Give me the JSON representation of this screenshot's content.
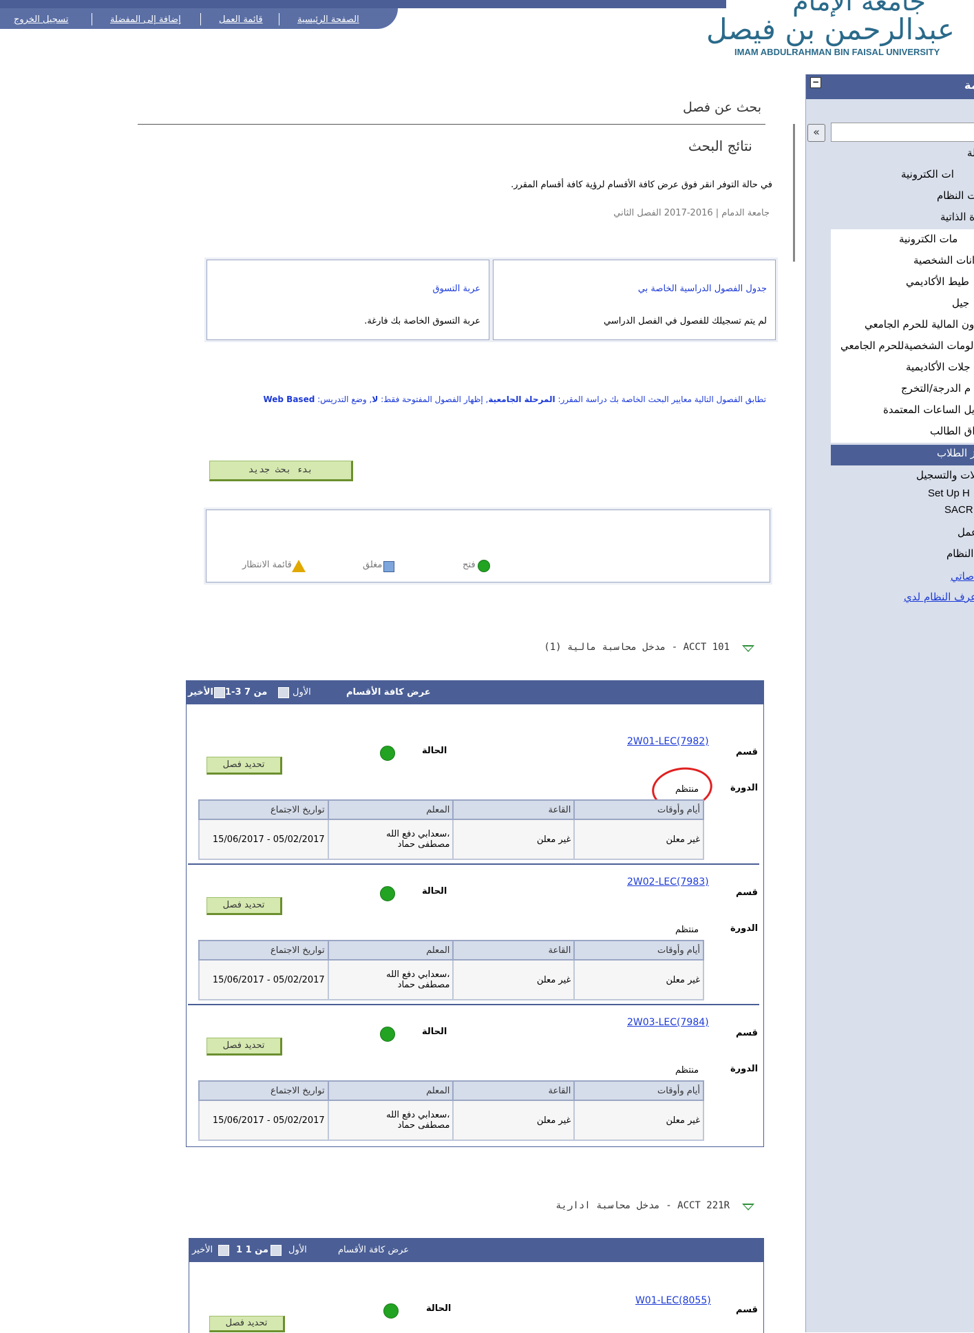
{
  "topnav": {
    "home": "الصفحة الرئيسية",
    "worklist": "قائمة العمل",
    "favorites": "إضافة إلى المفضلة",
    "logout": "تسجيل الخروج"
  },
  "logo": {
    "arabic_top": "جامعة الإمام",
    "arabic": "عبدالرحمن بن فيصل",
    "english": "IMAM ABDULRAHMAN BIN FAISAL UNIVERSITY"
  },
  "sidebar": {
    "title": "مة",
    "items": [
      "لة",
      "ات الكترونية",
      "ات النظام",
      "ة الذاتية",
      "مات الكترونية",
      "انات الشخصية",
      "طيط الأكاديمي",
      "جيل",
      "ون المالية للحرم الجامعي",
      "لومات الشخصيةللحرم الجامعي",
      "جلات الأكاديمية",
      "م الدرجة/التخرج",
      "يل الساعات المعتمدة",
      "اق الطالب",
      "ز الطلاب",
      "لات والتسجيل",
      "Set Up H",
      "SACR",
      "عمل",
      "النظام",
      "صاتي",
      "عرف النظام لدي"
    ]
  },
  "page": {
    "title": "بحث عن فصل",
    "subtitle": "نتائج البحث",
    "instruction": "في حالة التوفر انقر فوق عرض كافة الأقسام لرؤية كافة أقسام المقرر.",
    "term": "جامعة الدمام | 2016-2017 الفصل الثاني",
    "my_schedule_link": "جدول الفصول الدراسية الخاصة بي",
    "my_schedule_text": "لم يتم تسجيلك للفصول في الفصل الدراسي",
    "cart_link": "عربة التسوق",
    "cart_text": "عربة التسوق الخاصة بك فارغة.",
    "criteria_prefix": "تطابق الفصول التالية معايير البحث الخاصة بك دراسة المقرر: ",
    "criteria_career": "المرحلة الجامعية",
    "criteria_open": ",  إظهار الفصول المفتوحة فقط: ",
    "criteria_open_val": "لا",
    "criteria_mode": ",  وضع التدريس: ",
    "criteria_mode_val": "Web Based",
    "new_search": "بدء بحث جديد"
  },
  "legend": {
    "open": "فتح",
    "closed": "مغلق",
    "waitlist": "قائمة الانتظار"
  },
  "course1": {
    "title": "ACCT  101 - مدخل محاسبة مالية (1)",
    "view_all": "عرض كافة الأقسام",
    "first": "الأول",
    "range": "1-3 من 7",
    "last": "الأخير",
    "sections": [
      {
        "label": "قسم",
        "link": "2W01-LEC(7982)",
        "status_label": "الحالة",
        "session_label": "الدورة",
        "session": "منتظم",
        "button": "تحديد فصل",
        "headers": [
          "أيام وأوقات",
          "القاعة",
          "المعلم",
          "تواريخ الاجتماع"
        ],
        "row": [
          "غير معلن",
          "غير معلن",
          "سعدابي دفع الله،",
          "15/06/2017 - 05/02/2017"
        ],
        "instructor2": "مصطفى حماد"
      },
      {
        "label": "قسم",
        "link": "2W02-LEC(7983)",
        "status_label": "الحالة",
        "session_label": "الدورة",
        "session": "منتظم",
        "button": "تحديد فصل",
        "headers": [
          "أيام وأوقات",
          "القاعة",
          "المعلم",
          "تواريخ الاجتماع"
        ],
        "row": [
          "غير معلن",
          "غير معلن",
          "سعدابي دفع الله،",
          "15/06/2017 - 05/02/2017"
        ],
        "instructor2": "مصطفى حماد"
      },
      {
        "label": "قسم",
        "link": "2W03-LEC(7984)",
        "status_label": "الحالة",
        "session_label": "الدورة",
        "session": "منتظم",
        "button": "تحديد فصل",
        "headers": [
          "أيام وأوقات",
          "القاعة",
          "المعلم",
          "تواريخ الاجتماع"
        ],
        "row": [
          "غير معلن",
          "غير معلن",
          "سعدابي دفع الله،",
          "15/06/2017 - 05/02/2017"
        ],
        "instructor2": "مصطفى حماد"
      }
    ]
  },
  "course2": {
    "title": "ACCT  221R - مدخل محاسبة ادارية",
    "view_all": "عرض كافة الأقسام",
    "first": "الأول",
    "range": "1 من 1",
    "last": "الأخير",
    "section": {
      "label": "قسم",
      "link": "W01-LEC(8055)",
      "status_label": "الحالة",
      "button": "تحديد فصل"
    }
  },
  "colors": {
    "header_blue": "#4b5f96",
    "open_green": "#22a322",
    "annotation_red": "#e02020"
  }
}
